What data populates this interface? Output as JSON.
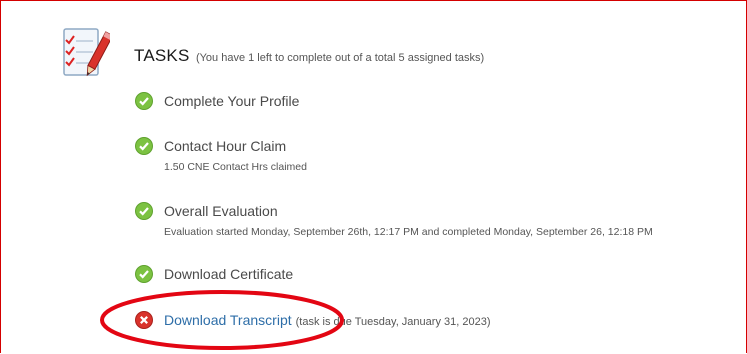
{
  "tasks_section": {
    "title": "TASKS",
    "summary": "(You have 1 left to complete out of a total 5 assigned tasks)",
    "icon": "checklist-pencil-icon",
    "items": [
      {
        "name": "Complete Your Profile",
        "status": "complete",
        "detail": ""
      },
      {
        "name": "Contact Hour Claim",
        "status": "complete",
        "detail": "1.50 CNE Contact Hrs claimed"
      },
      {
        "name": "Overall Evaluation",
        "status": "complete",
        "detail": "Evaluation started Monday, September 26th, 12:17 PM and completed Monday, September 26, 12:18 PM"
      },
      {
        "name": "Download Certificate",
        "status": "complete",
        "detail": ""
      },
      {
        "name": "Download Transcript",
        "status": "incomplete",
        "detail": "(task is due Tuesday, January 31, 2023)"
      }
    ]
  },
  "colors": {
    "complete": "#7cc242",
    "incomplete": "#d9322b",
    "link": "#2e6ea8",
    "annotation": "#e30613"
  }
}
